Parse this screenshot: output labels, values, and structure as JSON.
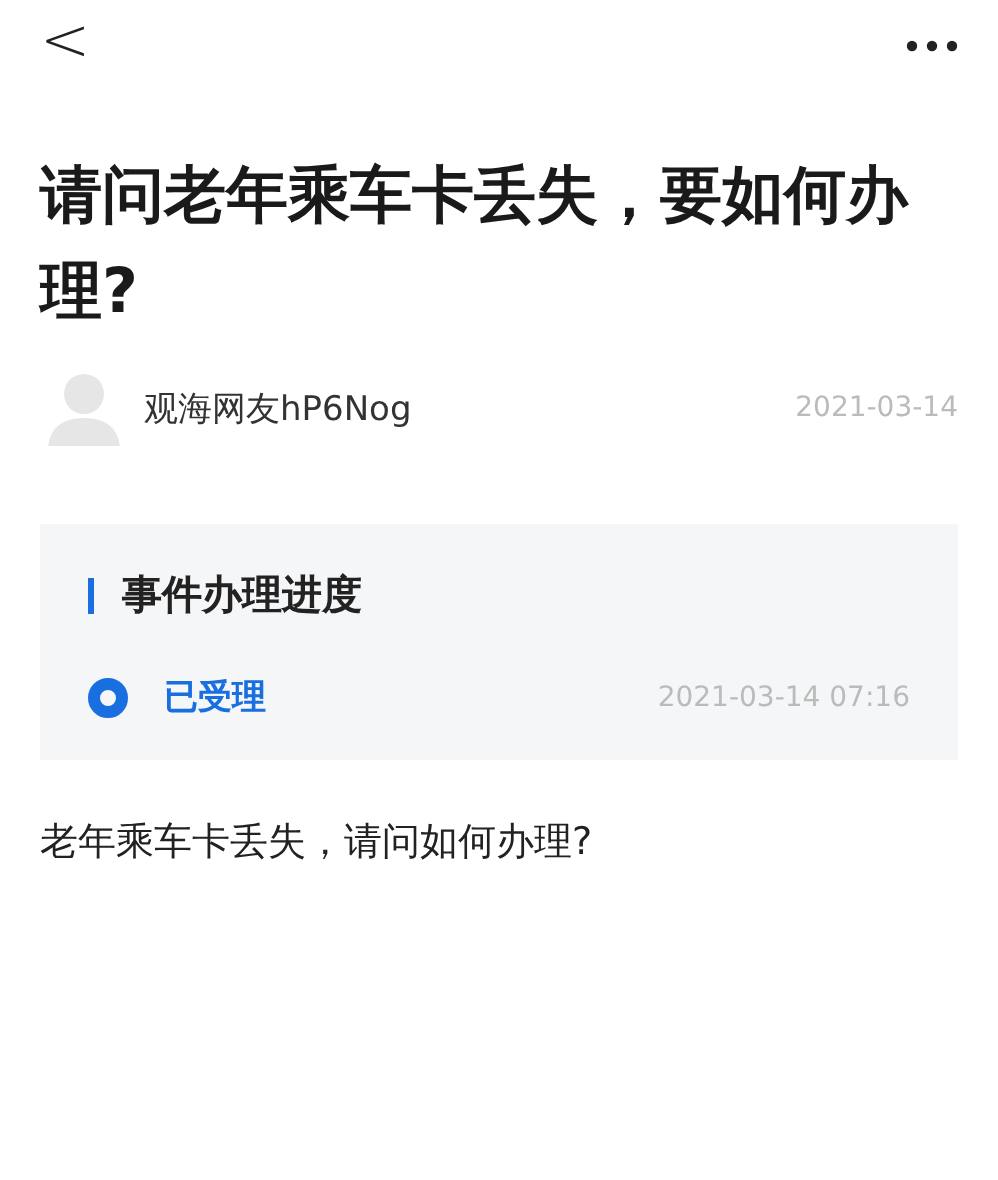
{
  "nav": {
    "back": "<"
  },
  "title": "请问老年乘车卡丢失，要如何办理?",
  "author": {
    "name": "观海网友hP6Nog",
    "date": "2021-03-14"
  },
  "progress": {
    "heading": "事件办理进度",
    "steps": [
      {
        "label": "已受理",
        "time": "2021-03-14 07:16"
      }
    ]
  },
  "body": "老年乘车卡丢失，请问如何办理?"
}
